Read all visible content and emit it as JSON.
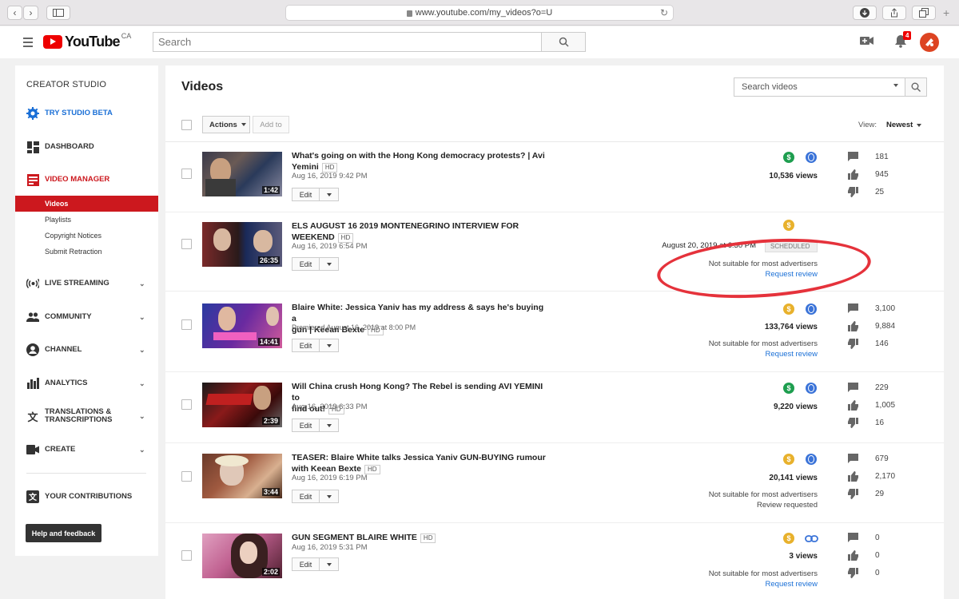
{
  "browser": {
    "url": "www.youtube.com/my_videos?o=U"
  },
  "header": {
    "logo_text": "YouTube",
    "logo_region": "CA",
    "search_placeholder": "Search",
    "notification_count": "4"
  },
  "sidebar": {
    "title": "CREATOR STUDIO",
    "try_beta": "TRY STUDIO BETA",
    "dashboard": "DASHBOARD",
    "video_manager": "VIDEO MANAGER",
    "sub_items": [
      "Videos",
      "Playlists",
      "Copyright Notices",
      "Submit Retraction"
    ],
    "live_streaming": "LIVE STREAMING",
    "community": "COMMUNITY",
    "channel": "CHANNEL",
    "analytics": "ANALYTICS",
    "translations_1": "TRANSLATIONS &",
    "translations_2": "TRANSCRIPTIONS",
    "create": "CREATE",
    "your_contributions": "YOUR CONTRIBUTIONS",
    "help": "Help and feedback"
  },
  "main": {
    "title": "Videos",
    "search_placeholder": "Search videos",
    "actions_label": "Actions",
    "add_to_label": "Add to",
    "view_label": "View:",
    "view_value": "Newest",
    "edit_label": "Edit"
  },
  "videos": [
    {
      "title_1": "What's going on with the Hong Kong democracy protests? | Avi",
      "title_2": "Yemini",
      "hd": "HD",
      "date": "Aug 16, 2019 9:42 PM",
      "duration": "1:42",
      "monetization": "green",
      "views": "10,536 views",
      "comments": "181",
      "likes": "945",
      "dislikes": "25"
    },
    {
      "title_1": "ELS AUGUST 16 2019 MONTENEGRINO INTERVIEW FOR",
      "title_2": "WEEKEND",
      "hd": "HD",
      "date": "Aug 16, 2019 6:54 PM",
      "duration": "26:35",
      "monetization": "yellow",
      "scheduled_time": "August 20, 2019 at 6:30 PM",
      "scheduled_badge": "SCHEDULED",
      "notice": "Not suitable for most advertisers",
      "review": "Request review"
    },
    {
      "title_1": "Blaire White: Jessica Yaniv has my address & says he's buying a",
      "title_2": "gun | Keean Bexte",
      "hd": "HD",
      "date": "Premiered August 16, 2019 at 8:00 PM",
      "duration": "14:41",
      "monetization": "yellow",
      "views": "133,764 views",
      "notice": "Not suitable for most advertisers",
      "review": "Request review",
      "comments": "3,100",
      "likes": "9,884",
      "dislikes": "146"
    },
    {
      "title_1": "Will China crush Hong Kong? The Rebel is sending AVI YEMINI to",
      "title_2": "find out!",
      "hd": "HD",
      "date": "Aug 16, 2019 6:33 PM",
      "duration": "2:39",
      "monetization": "green",
      "views": "9,220 views",
      "comments": "229",
      "likes": "1,005",
      "dislikes": "16"
    },
    {
      "title_1": "TEASER: Blaire White talks Jessica Yaniv GUN-BUYING rumour",
      "title_2": "with Keean Bexte",
      "hd": "HD",
      "date": "Aug 16, 2019 6:19 PM",
      "duration": "3:44",
      "monetization": "yellow",
      "views": "20,141 views",
      "notice": "Not suitable for most advertisers",
      "review": "Review requested",
      "comments": "679",
      "likes": "2,170",
      "dislikes": "29"
    },
    {
      "title_1": "GUN SEGMENT BLAIRE WHITE",
      "hd": "HD",
      "date": "Aug 16, 2019 5:31 PM",
      "duration": "2:02",
      "monetization": "yellow",
      "views": "3 views",
      "notice": "Not suitable for most advertisers",
      "review": "Request review",
      "comments": "0",
      "likes": "0",
      "dislikes": "0"
    }
  ],
  "colors": {
    "brand_red": "#cc181e",
    "monetized_green": "#1e9e4f",
    "limited_yellow": "#e8b12c",
    "link_blue": "#1a6fd6",
    "annotation_red": "#e5323b"
  }
}
